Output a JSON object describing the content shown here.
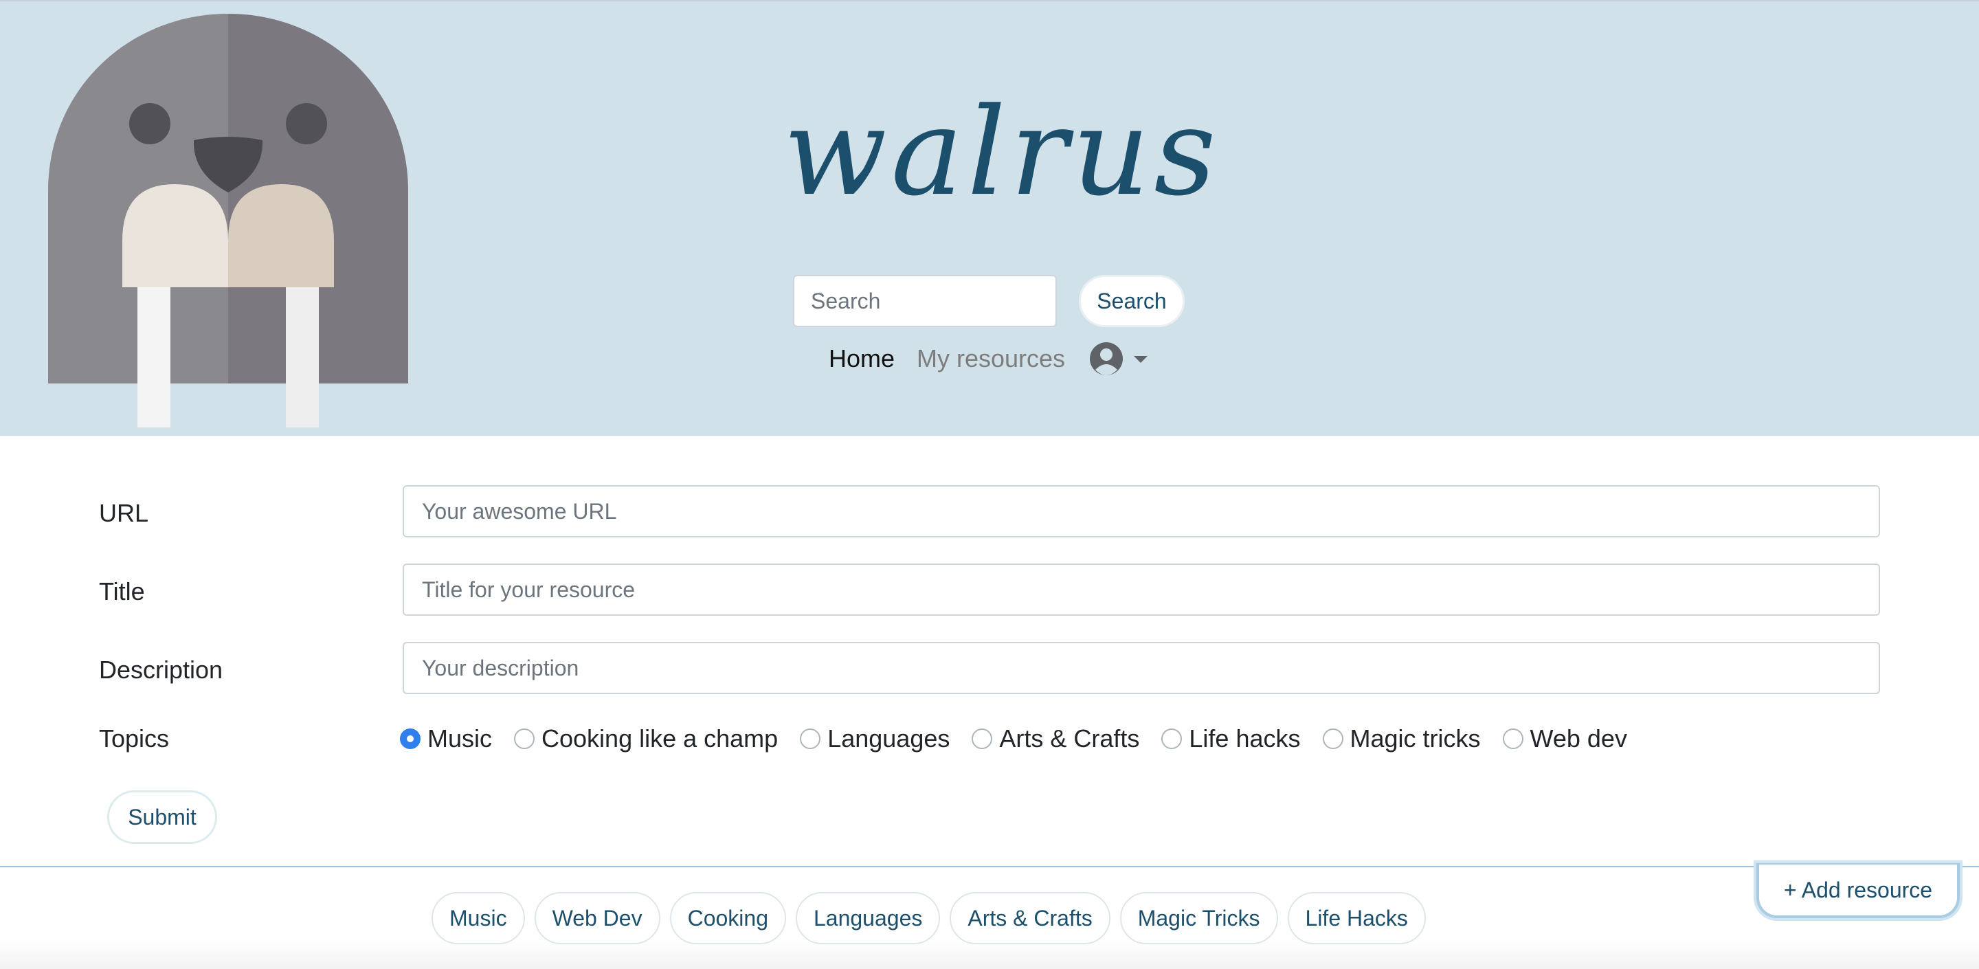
{
  "header": {
    "brand": "walrus",
    "search": {
      "placeholder": "Search",
      "button_label": "Search"
    },
    "nav": {
      "home": "Home",
      "my_resources": "My resources"
    }
  },
  "form": {
    "url": {
      "label": "URL",
      "placeholder": "Your awesome URL"
    },
    "title": {
      "label": "Title",
      "placeholder": "Title for your resource"
    },
    "description": {
      "label": "Description",
      "placeholder": "Your description"
    },
    "topics": {
      "label": "Topics",
      "options": [
        "Music",
        "Cooking like a champ",
        "Languages",
        "Arts & Crafts",
        "Life hacks",
        "Magic tricks",
        "Web dev"
      ],
      "selected": "Music"
    },
    "submit_label": "Submit"
  },
  "filters": [
    "Music",
    "Web Dev",
    "Cooking",
    "Languages",
    "Arts & Crafts",
    "Magic Tricks",
    "Life Hacks"
  ],
  "add_resource_label": "+ Add resource",
  "colors": {
    "header_bg": "#d0e1e9",
    "brand": "#1c4f6c",
    "accent": "#2f80ed",
    "divider": "#9fc3d6"
  },
  "icons": {
    "logo": "walrus-logo",
    "user": "user-avatar-icon",
    "caret": "caret-down-icon"
  }
}
